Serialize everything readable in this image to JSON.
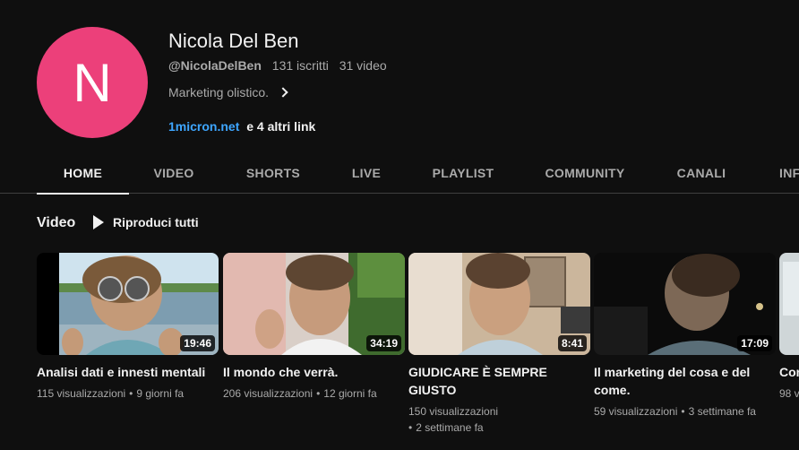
{
  "channel": {
    "avatar_letter": "N",
    "avatar_color": "#ec407a",
    "name": "Nicola Del Ben",
    "handle": "@NicolaDelBen",
    "subscribers": "131 iscritti",
    "videos_count": "31 video",
    "description": "Marketing olistico.",
    "link": "1micron.net",
    "more_links": "e 4 altri link"
  },
  "tabs": [
    {
      "label": "HOME",
      "active": true
    },
    {
      "label": "VIDEO"
    },
    {
      "label": "SHORTS"
    },
    {
      "label": "LIVE"
    },
    {
      "label": "PLAYLIST"
    },
    {
      "label": "COMMUNITY"
    },
    {
      "label": "CANALI"
    },
    {
      "label": "INF"
    }
  ],
  "section": {
    "title": "Video",
    "play_all": "Riproduci tutti"
  },
  "videos": [
    {
      "title": "Analisi dati e innesti mentali",
      "duration": "19:46",
      "views": "115 visualizzazioni",
      "age": "9 giorni fa"
    },
    {
      "title": "Il mondo che verrà.",
      "duration": "34:19",
      "views": "206 visualizzazioni",
      "age": "12 giorni fa"
    },
    {
      "title": "GIUDICARE È SEMPRE GIUSTO",
      "duration": "8:41",
      "views": "150 visualizzazioni",
      "age": "2 settimane fa"
    },
    {
      "title": "Il marketing del cosa e del come.",
      "duration": "17:09",
      "views": "59 visualizzazioni",
      "age": "3 settimane fa"
    },
    {
      "title": "Con",
      "duration": "",
      "views": "98 v",
      "age": ""
    }
  ],
  "colors": {
    "background": "#0f0f0f",
    "link": "#3ea6ff",
    "secondary_text": "#aaaaaa"
  }
}
